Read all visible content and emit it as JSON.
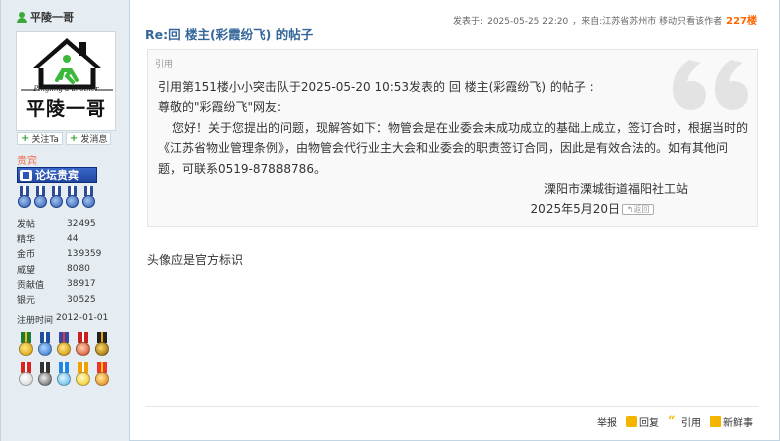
{
  "sidebar": {
    "username": "平陵一哥",
    "avatar_sub": "Pingling a brother",
    "avatar_name": "平陵一哥",
    "follow_label": "关注Ta",
    "message_label": "发消息",
    "group": "贵宾",
    "badge": "论坛贵宾",
    "stats": [
      {
        "k": "发帖",
        "v": "32495"
      },
      {
        "k": "精华",
        "v": "44"
      },
      {
        "k": "金币",
        "v": "139359"
      },
      {
        "k": "威望",
        "v": "8080"
      },
      {
        "k": "贡献值",
        "v": "38917"
      },
      {
        "k": "银元",
        "v": "30525"
      }
    ],
    "reg_label": "注册时间",
    "reg_date": "2012-01-01"
  },
  "post": {
    "posted_label": "发表于:",
    "posted_time": "2025-05-25 22:20",
    "source": "，来自:江苏省苏州市 移动",
    "author_only": "只看该作者",
    "floor": "227楼",
    "title": "Re:回 楼主(彩霞纷飞) 的帖子",
    "quote_label": "引用",
    "quote_lines": {
      "l1": "引用第151楼小小突击队于2025-05-20 10:53发表的 回 楼主(彩霞纷飞) 的帖子 :",
      "l2": "尊敬的\"彩霞纷飞\"网友:",
      "l3": "您好！关于您提出的问题，现解答如下：物管会是在业委会未成功成立的基础上成立，签订合时，根据当时的《江苏省物业管理条例》，由物管会代行业主大会和业委会的职责签订合同，因此是有效合法的。如有其他问题，可联系0519-87888786。",
      "l4": "溧阳市溧城街道福阳社工站",
      "l5": "2025年5月20日"
    },
    "back_label": "返回",
    "reply_text": "头像应是官方标识"
  },
  "footer": {
    "report": "举报",
    "reply": "回复",
    "quote": "引用",
    "news": "新鲜事"
  },
  "colors": {
    "sidebar_bg": "#e5edf2",
    "title": "#336699",
    "floor": "#ff6600",
    "group": "#f26c4f"
  }
}
